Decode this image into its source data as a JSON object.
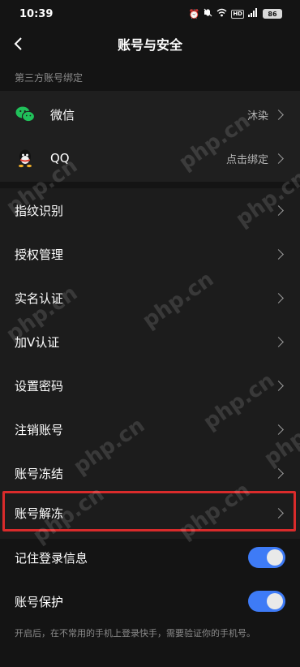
{
  "status_bar": {
    "time": "10:39",
    "battery": "86",
    "icons": [
      "alarm-icon",
      "mute-icon",
      "wifi-icon",
      "hd-icon",
      "signal-icon",
      "battery-icon"
    ]
  },
  "header": {
    "title": "账号与安全"
  },
  "third_party": {
    "section_title": "第三方账号绑定",
    "items": [
      {
        "label": "微信",
        "value": "沐染",
        "icon": "wechat-icon"
      },
      {
        "label": "QQ",
        "value": "点击绑定",
        "icon": "qq-icon"
      }
    ]
  },
  "menu": {
    "items": [
      {
        "label": "指纹识别"
      },
      {
        "label": "授权管理"
      },
      {
        "label": "实名认证"
      },
      {
        "label": "加V认证"
      },
      {
        "label": "设置密码"
      },
      {
        "label": "注销账号"
      },
      {
        "label": "账号冻结"
      },
      {
        "label": "账号解冻"
      }
    ]
  },
  "toggles": [
    {
      "label": "记住登录信息",
      "on": true
    },
    {
      "label": "账号保护",
      "on": true
    }
  ],
  "footnote": "开启后，在不常用的手机上登录快手，需要验证你的手机号。",
  "colors": {
    "background": "#141414",
    "card": "#1f1f1f",
    "toggle_on": "#3e7bf6",
    "highlight": "#d92b2b",
    "wechat": "#20c15a"
  },
  "watermark": "php.cn"
}
